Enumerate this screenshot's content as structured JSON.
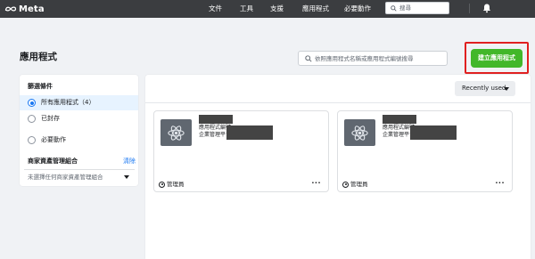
{
  "nav": {
    "brand": "Meta",
    "links": [
      "文件",
      "工具",
      "支援",
      "應用程式",
      "必要動作"
    ],
    "search_placeholder": "搜尋"
  },
  "page": {
    "title": "應用程式",
    "search_placeholder": "依照應用程式名稱或應用程式編號搜尋",
    "create_button": "建立應用程式"
  },
  "filters": {
    "title": "篩選條件",
    "options": [
      {
        "label": "所有應用程式（4）",
        "selected": true
      },
      {
        "label": "已封存",
        "selected": false
      },
      {
        "label": "必要動作",
        "selected": false
      }
    ],
    "business": {
      "title": "商家資產管理組合",
      "clear": "清除",
      "placeholder": "未選擇任何商家資產管理組合"
    }
  },
  "sort": {
    "label": "Recently used"
  },
  "apps": [
    {
      "id_label": "應用程式編號",
      "platform": "企業管理平台",
      "role": "管理員",
      "more": "···"
    },
    {
      "id_label": "應用程式編號",
      "platform": "企業管理平台",
      "role": "管理員",
      "more": "···"
    }
  ],
  "colors": {
    "nav_bg": "#3b3d40",
    "accent": "#1877f2",
    "create_green": "#42b72a",
    "highlight_red": "#e02020"
  }
}
